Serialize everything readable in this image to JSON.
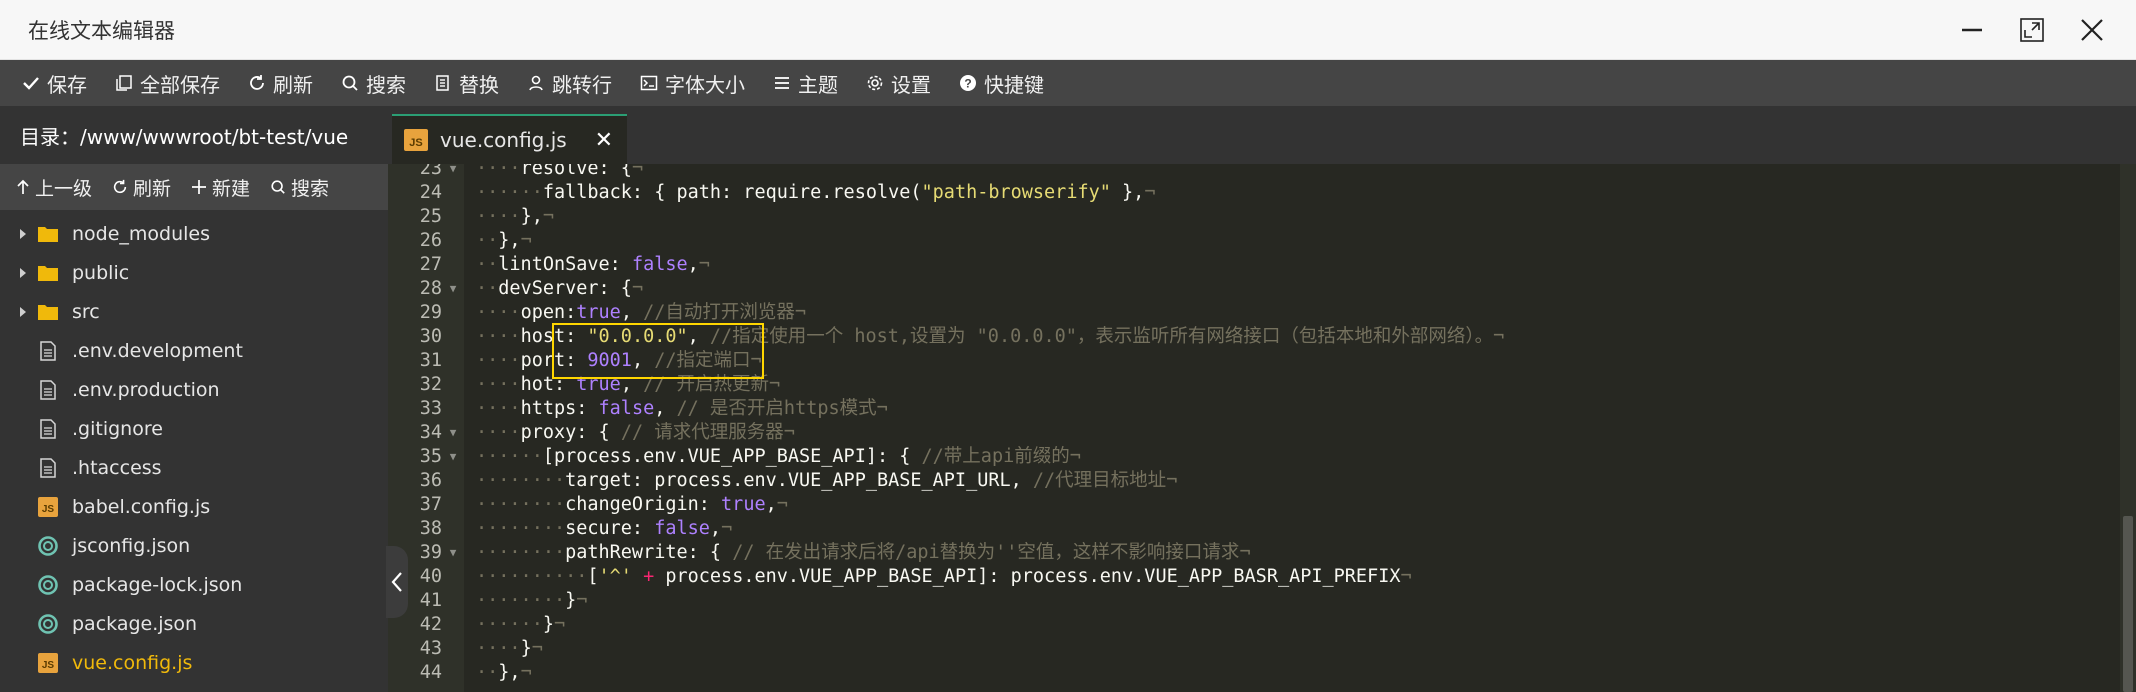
{
  "window": {
    "title": "在线文本编辑器"
  },
  "toolbar": {
    "items": [
      {
        "label": "保存",
        "icon": "check-icon"
      },
      {
        "label": "全部保存",
        "icon": "copy-icon"
      },
      {
        "label": "刷新",
        "icon": "refresh-icon"
      },
      {
        "label": "搜索",
        "icon": "search-icon"
      },
      {
        "label": "替换",
        "icon": "replace-icon"
      },
      {
        "label": "跳转行",
        "icon": "jump-icon"
      },
      {
        "label": "字体大小",
        "icon": "font-size-icon"
      },
      {
        "label": "主题",
        "icon": "menu-icon"
      },
      {
        "label": "设置",
        "icon": "gear-icon"
      },
      {
        "label": "快捷键",
        "icon": "help-icon"
      }
    ]
  },
  "sidebar": {
    "path_label": "目录：/www/wwwroot/bt-test/vue",
    "tools": [
      {
        "label": "上一级",
        "icon": "arrow-up-icon"
      },
      {
        "label": "刷新",
        "icon": "refresh-icon"
      },
      {
        "label": "新建",
        "icon": "plus-icon"
      },
      {
        "label": "搜索",
        "icon": "search-icon"
      }
    ],
    "files": [
      {
        "name": "node_modules",
        "type": "folder"
      },
      {
        "name": "public",
        "type": "folder"
      },
      {
        "name": "src",
        "type": "folder"
      },
      {
        "name": ".env.development",
        "type": "file"
      },
      {
        "name": ".env.production",
        "type": "file"
      },
      {
        "name": ".gitignore",
        "type": "file"
      },
      {
        "name": ".htaccess",
        "type": "file"
      },
      {
        "name": "babel.config.js",
        "type": "js"
      },
      {
        "name": "jsconfig.json",
        "type": "json"
      },
      {
        "name": "package-lock.json",
        "type": "json"
      },
      {
        "name": "package.json",
        "type": "json"
      },
      {
        "name": "vue.config.js",
        "type": "js",
        "active": true
      }
    ]
  },
  "tab": {
    "label": "vue.config.js",
    "close": "✕",
    "badge": "JS"
  },
  "editor": {
    "lines": [
      {
        "n": "23",
        "fold": true,
        "parts": [
          [
            "w",
            "····"
          ],
          [
            "",
            "resolve: {"
          ],
          [
            "w",
            "¬"
          ]
        ]
      },
      {
        "n": "24",
        "parts": [
          [
            "w",
            "······"
          ],
          [
            "",
            "fallback: { path: require.resolve("
          ],
          [
            "s",
            "\"path-browserify\""
          ],
          [
            "",
            " },"
          ],
          [
            "w",
            "¬"
          ]
        ]
      },
      {
        "n": "25",
        "parts": [
          [
            "w",
            "····"
          ],
          [
            "",
            "},"
          ],
          [
            "w",
            "¬"
          ]
        ]
      },
      {
        "n": "26",
        "parts": [
          [
            "w",
            "··"
          ],
          [
            "",
            "},"
          ],
          [
            "w",
            "¬"
          ]
        ]
      },
      {
        "n": "27",
        "parts": [
          [
            "w",
            "··"
          ],
          [
            "",
            "lintOnSave: "
          ],
          [
            "v",
            "false"
          ],
          [
            "",
            ","
          ],
          [
            "w",
            "¬"
          ]
        ]
      },
      {
        "n": "28",
        "fold": true,
        "parts": [
          [
            "w",
            "··"
          ],
          [
            "",
            "devServer: {"
          ],
          [
            "w",
            "¬"
          ]
        ]
      },
      {
        "n": "29",
        "parts": [
          [
            "w",
            "····"
          ],
          [
            "",
            "open:"
          ],
          [
            "v",
            "true"
          ],
          [
            "",
            ", "
          ],
          [
            "c",
            "//自动打开浏览器"
          ],
          [
            "w",
            "¬"
          ]
        ]
      },
      {
        "n": "30",
        "parts": [
          [
            "w",
            "····"
          ],
          [
            "",
            "host: "
          ],
          [
            "s",
            "\"0.0.0.0\""
          ],
          [
            "",
            ", "
          ],
          [
            "c",
            "//指定使用一个 host,设置为 \"0.0.0.0\"，表示监听所有网络接口（包括本地和外部网络）。"
          ],
          [
            "w",
            "¬"
          ]
        ]
      },
      {
        "n": "31",
        "parts": [
          [
            "w",
            "····"
          ],
          [
            "",
            "port: "
          ],
          [
            "v",
            "9001"
          ],
          [
            "",
            ", "
          ],
          [
            "c",
            "//指定端口"
          ],
          [
            "w",
            "¬"
          ]
        ]
      },
      {
        "n": "32",
        "parts": [
          [
            "w",
            "····"
          ],
          [
            "",
            "hot: "
          ],
          [
            "v",
            "true"
          ],
          [
            "",
            ", "
          ],
          [
            "c",
            "// 开启热更新"
          ],
          [
            "w",
            "¬"
          ]
        ]
      },
      {
        "n": "33",
        "parts": [
          [
            "w",
            "····"
          ],
          [
            "",
            "https: "
          ],
          [
            "v",
            "false"
          ],
          [
            "",
            ", "
          ],
          [
            "c",
            "// 是否开启https模式"
          ],
          [
            "w",
            "¬"
          ]
        ]
      },
      {
        "n": "34",
        "fold": true,
        "parts": [
          [
            "w",
            "····"
          ],
          [
            "",
            "proxy: { "
          ],
          [
            "c",
            "// 请求代理服务器"
          ],
          [
            "w",
            "¬"
          ]
        ]
      },
      {
        "n": "35",
        "fold": true,
        "parts": [
          [
            "w",
            "······"
          ],
          [
            "",
            "[process.env.VUE_APP_BASE_API]: { "
          ],
          [
            "c",
            "//带上api前缀的"
          ],
          [
            "w",
            "¬"
          ]
        ]
      },
      {
        "n": "36",
        "parts": [
          [
            "w",
            "········"
          ],
          [
            "",
            "target: process.env.VUE_APP_BASE_API_URL, "
          ],
          [
            "c",
            "//代理目标地址"
          ],
          [
            "w",
            "¬"
          ]
        ]
      },
      {
        "n": "37",
        "parts": [
          [
            "w",
            "········"
          ],
          [
            "",
            "changeOrigin: "
          ],
          [
            "v",
            "true"
          ],
          [
            "",
            ","
          ],
          [
            "w",
            "¬"
          ]
        ]
      },
      {
        "n": "38",
        "parts": [
          [
            "w",
            "········"
          ],
          [
            "",
            "secure: "
          ],
          [
            "v",
            "false"
          ],
          [
            "",
            ","
          ],
          [
            "w",
            "¬"
          ]
        ]
      },
      {
        "n": "39",
        "fold": true,
        "parts": [
          [
            "w",
            "········"
          ],
          [
            "",
            "pathRewrite: { "
          ],
          [
            "c",
            "// 在发出请求后将/api替换为''空值，这样不影响接口请求"
          ],
          [
            "w",
            "¬"
          ]
        ]
      },
      {
        "n": "40",
        "parts": [
          [
            "w",
            "··········"
          ],
          [
            "",
            "["
          ],
          [
            "s",
            "'^'"
          ],
          [
            "",
            " "
          ],
          [
            "p",
            "+"
          ],
          [
            "",
            " process.env.VUE_APP_BASE_API]: process.env.VUE_APP_BASR_API_PREFIX"
          ],
          [
            "w",
            "¬"
          ]
        ]
      },
      {
        "n": "41",
        "parts": [
          [
            "w",
            "········"
          ],
          [
            "",
            "}"
          ],
          [
            "w",
            "¬"
          ]
        ]
      },
      {
        "n": "42",
        "parts": [
          [
            "w",
            "······"
          ],
          [
            "",
            "}"
          ],
          [
            "w",
            "¬"
          ]
        ]
      },
      {
        "n": "43",
        "parts": [
          [
            "w",
            "····"
          ],
          [
            "",
            "}"
          ],
          [
            "w",
            "¬"
          ]
        ]
      },
      {
        "n": "44",
        "parts": [
          [
            "w",
            "··"
          ],
          [
            "",
            "},"
          ],
          [
            "w",
            "¬"
          ]
        ]
      }
    ]
  }
}
